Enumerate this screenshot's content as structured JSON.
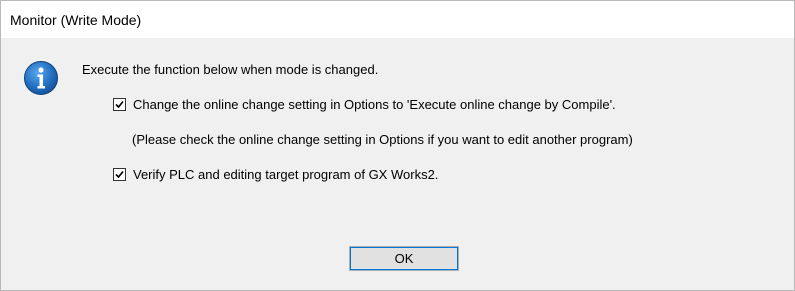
{
  "window": {
    "title": "Monitor (Write Mode)"
  },
  "dialog": {
    "icon": "info-icon",
    "message": "Execute the function below when mode is changed.",
    "options": [
      {
        "label": "Change the online change setting in Options to 'Execute online change by Compile'.",
        "checked": true
      },
      {
        "label": "Verify PLC and editing target program of GX Works2.",
        "checked": true
      }
    ],
    "note": "(Please check the online change setting in Options if you want to edit another program)",
    "ok_label": "OK"
  },
  "colors": {
    "titlebar_bg": "#ffffff",
    "dialog_bg": "#f0f0f0",
    "icon_blue": "#1c68b8",
    "button_focus": "#0078d7"
  }
}
